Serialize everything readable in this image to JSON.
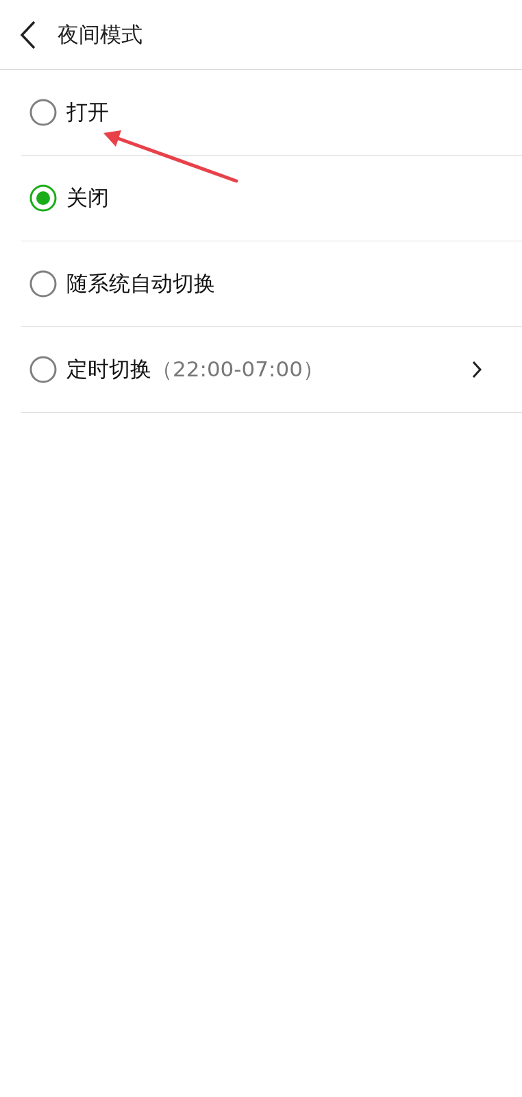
{
  "header": {
    "title": "夜间模式"
  },
  "options": [
    {
      "kind": "plain",
      "label": "打开",
      "selected": false
    },
    {
      "kind": "plain",
      "label": "关闭",
      "selected": true
    },
    {
      "kind": "plain",
      "label": "随系统自动切换",
      "selected": false
    },
    {
      "kind": "navigate",
      "label": "定时切换",
      "detail": "（22:00-07:00）",
      "selected": false
    }
  ]
}
